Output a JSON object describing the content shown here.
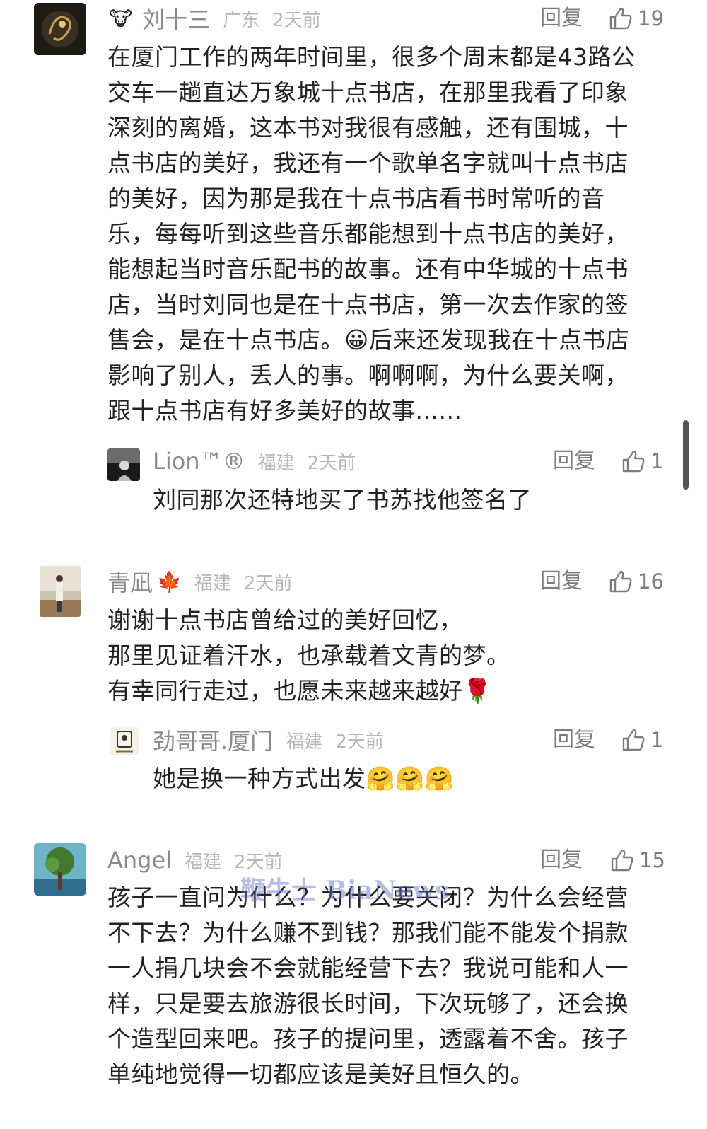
{
  "comments": [
    {
      "name": "刘十三",
      "badge": "🐮",
      "location": "广东",
      "time": "2天前",
      "reply_label": "回复",
      "likes": "19",
      "text": "在厦门工作的两年时间里，很多个周末都是43路公\n交车一趟直达万象城十点书店，在那里我看了印象\n深刻的离婚，这本书对我很有感触，还有围城，十\n点书店的美好，我还有一个歌单名字就叫十点书店\n的美好，因为那是我在十点书店看书时常听的音\n乐，每每听到这些音乐都能想到十点书店的美好，\n能想起当时音乐配书的故事。还有中华城的十点书\n店，当时刘同也是在十点书店，第一次去作家的签\n售会，是在十点书店。😀后来还发现我在十点书店\n影响了别人，丢人的事。啊啊啊，为什么要关啊，\n跟十点书店有好多美好的故事......",
      "reply": {
        "name": "Lion™®",
        "location": "福建",
        "time": "2天前",
        "reply_label": "回复",
        "likes": "1",
        "text": "刘同那次还特地买了书苏找他签名了"
      }
    },
    {
      "name": "青凪",
      "badge": "🍁",
      "location": "福建",
      "time": "2天前",
      "reply_label": "回复",
      "likes": "16",
      "text": "谢谢十点书店曾给过的美好回忆，\n那里见证着汗水，也承载着文青的梦。\n有幸同行走过，也愿未来越来越好🌹",
      "reply": {
        "name": "劲哥哥.厦门",
        "location": "福建",
        "time": "2天前",
        "reply_label": "回复",
        "likes": "1",
        "text": "她是换一种方式出发🤗🤗🤗"
      }
    },
    {
      "name": "Angel",
      "badge": "",
      "location": "福建",
      "time": "2天前",
      "reply_label": "回复",
      "likes": "15",
      "text": "孩子一直问为什么？为什么要关闭？为什么会经营\n不下去？为什么赚不到钱？那我们能不能发个捐款\n一人捐几块会不会就能经营下去？我说可能和人一\n样，只是要去旅游很长时间，下次玩够了，还会换\n个造型回来吧。孩子的提问里，透露着不舍。孩子\n单纯地觉得一切都应该是美好且恒久的。"
    }
  ],
  "watermark": "鞭牛士 BiaNews"
}
